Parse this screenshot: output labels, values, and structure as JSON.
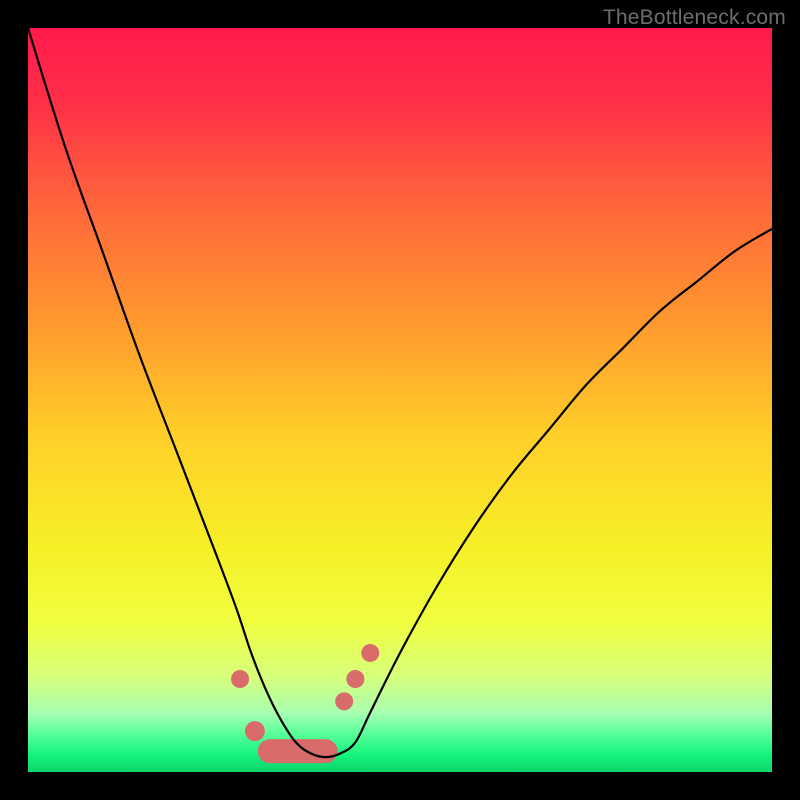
{
  "watermark": "TheBottleneck.com",
  "chart_data": {
    "type": "line",
    "title": "",
    "xlabel": "",
    "ylabel": "",
    "xlim": [
      0,
      100
    ],
    "ylim": [
      0,
      100
    ],
    "background_gradient": {
      "stops": [
        {
          "pos": 0.0,
          "color": "#ff1a4d"
        },
        {
          "pos": 0.1,
          "color": "#ff2f47"
        },
        {
          "pos": 0.25,
          "color": "#ff6a3a"
        },
        {
          "pos": 0.4,
          "color": "#ff9a2e"
        },
        {
          "pos": 0.55,
          "color": "#ffd028"
        },
        {
          "pos": 0.7,
          "color": "#f6f028"
        },
        {
          "pos": 0.8,
          "color": "#f0ff40"
        },
        {
          "pos": 0.87,
          "color": "#d8ff7a"
        },
        {
          "pos": 0.92,
          "color": "#a8ffb0"
        },
        {
          "pos": 0.95,
          "color": "#55ff99"
        },
        {
          "pos": 0.975,
          "color": "#17f57e"
        },
        {
          "pos": 1.0,
          "color": "#0ed46b"
        }
      ]
    },
    "series": [
      {
        "name": "bottleneck-curve",
        "color": "#000000",
        "x": [
          0,
          5,
          10,
          15,
          20,
          25,
          28,
          30,
          32,
          34,
          36,
          38,
          40,
          42,
          44,
          46,
          50,
          55,
          60,
          65,
          70,
          75,
          80,
          85,
          90,
          95,
          100
        ],
        "y": [
          100,
          84,
          70,
          56,
          43,
          30,
          22,
          16,
          11,
          7,
          4,
          2.5,
          2,
          2.5,
          4,
          8,
          16,
          25,
          33,
          40,
          46,
          52,
          57,
          62,
          66,
          70,
          73
        ]
      }
    ],
    "markers": {
      "color": "#d96b6b",
      "radius_small": 9,
      "radius_pill": 12,
      "points": [
        {
          "x": 28.5,
          "y": 12.5,
          "r": 9
        },
        {
          "x": 30.5,
          "y": 5.5,
          "r": 10
        },
        {
          "x": 42.5,
          "y": 9.5,
          "r": 9
        },
        {
          "x": 44.0,
          "y": 12.5,
          "r": 9
        },
        {
          "x": 46.0,
          "y": 16.0,
          "r": 9
        }
      ],
      "pill": {
        "x1": 32.5,
        "x2": 40.0,
        "y": 2.8,
        "r": 12
      }
    }
  }
}
